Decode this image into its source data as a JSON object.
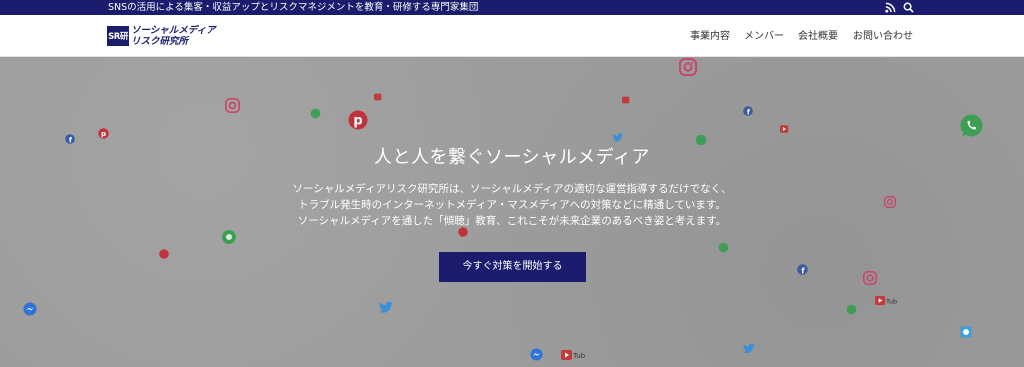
{
  "topbar": {
    "tagline": "SNSの活用による集客・収益アップとリスクマネジメントを教育・研修する専門家集団",
    "icons": [
      "rss-icon",
      "search-icon"
    ]
  },
  "header": {
    "logo": {
      "mark": "SR研",
      "line1": "ソーシャルメディア",
      "line2": "リスク研究所"
    },
    "nav": [
      {
        "label": "事業内容"
      },
      {
        "label": "メンバー"
      },
      {
        "label": "会社概要"
      },
      {
        "label": "お問い合わせ"
      }
    ]
  },
  "hero": {
    "headline": "人と人を繋ぐソーシャルメディア",
    "description": [
      "ソーシャルメディアリスク研究所は、ソーシャルメディアの適切な運営指導するだけでなく、",
      "トラブル発生時のインターネットメディア・マスメディアへの対策などに精通しています。",
      "ソーシャルメディアを通した「傾聴」教育、これこそが未来企業のあるべき姿と考えます。"
    ],
    "cta_label": "今すぐ対策を開始する",
    "background_icons": [
      "instagram-icon",
      "whatsapp-icon",
      "pinterest-icon",
      "facebook-icon",
      "twitter-icon",
      "youtube-icon",
      "messenger-icon",
      "rss-icon"
    ]
  },
  "colors": {
    "brand": "#1b1c6e",
    "hero_bg": "#9c9c9c",
    "header_bg": "#ffffff"
  }
}
